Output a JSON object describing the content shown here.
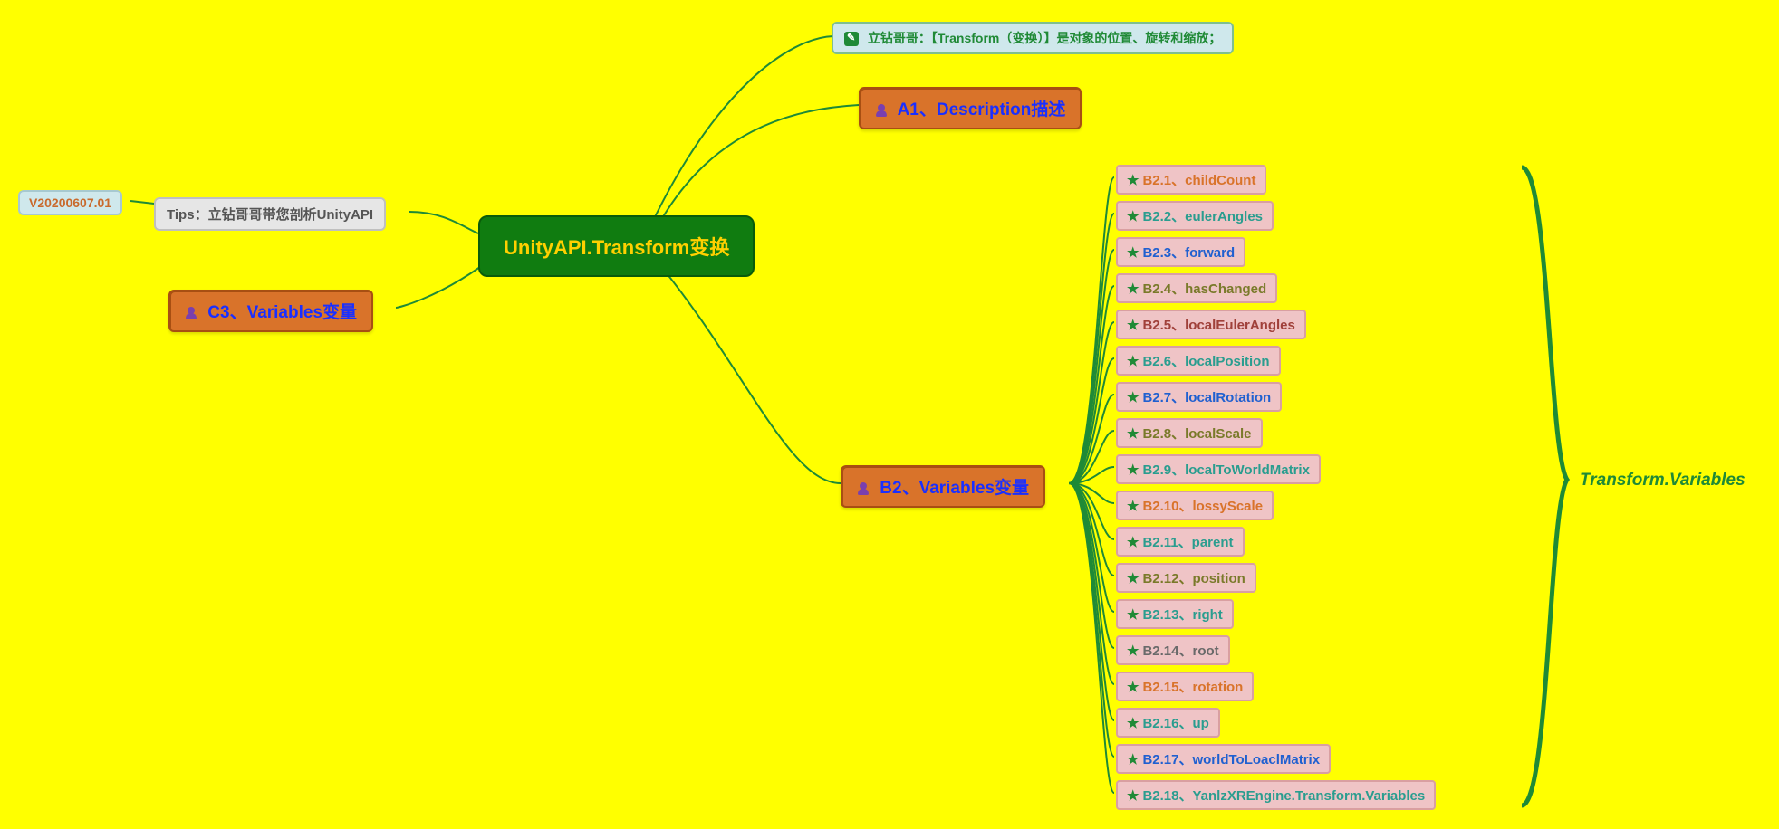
{
  "version": "V20200607.01",
  "tips": "Tips：立钻哥哥带您剖析UnityAPI",
  "root": "UnityAPI.Transform变换",
  "callout": "立钻哥哥：【Transform（变换）】是对象的位置、旋转和缩放；",
  "nodes": {
    "a1": "A1、Description描述",
    "b2": "B2、Variables变量",
    "c3": "C3、Variables变量"
  },
  "brace_label": "Transform.Variables",
  "leaves": [
    {
      "label": "B2.1、childCount",
      "cls": "c-orange"
    },
    {
      "label": "B2.2、eulerAngles",
      "cls": "c-teal"
    },
    {
      "label": "B2.3、forward",
      "cls": "c-blue"
    },
    {
      "label": "B2.4、hasChanged",
      "cls": "c-olive"
    },
    {
      "label": "B2.5、localEulerAngles",
      "cls": "c-dred"
    },
    {
      "label": "B2.6、localPosition",
      "cls": "c-teal"
    },
    {
      "label": "B2.7、localRotation",
      "cls": "c-blue"
    },
    {
      "label": "B2.8、localScale",
      "cls": "c-olive"
    },
    {
      "label": "B2.9、localToWorldMatrix",
      "cls": "c-teal"
    },
    {
      "label": "B2.10、lossyScale",
      "cls": "c-orange"
    },
    {
      "label": "B2.11、parent",
      "cls": "c-teal"
    },
    {
      "label": "B2.12、position",
      "cls": "c-olive"
    },
    {
      "label": "B2.13、right",
      "cls": "c-teal"
    },
    {
      "label": "B2.14、root",
      "cls": "c-gray"
    },
    {
      "label": "B2.15、rotation",
      "cls": "c-orange"
    },
    {
      "label": "B2.16、up",
      "cls": "c-teal"
    },
    {
      "label": "B2.17、worldToLoaclMatrix",
      "cls": "c-blue"
    },
    {
      "label": "B2.18、YanlzXREngine.Transform.Variables",
      "cls": "c-teal"
    }
  ]
}
